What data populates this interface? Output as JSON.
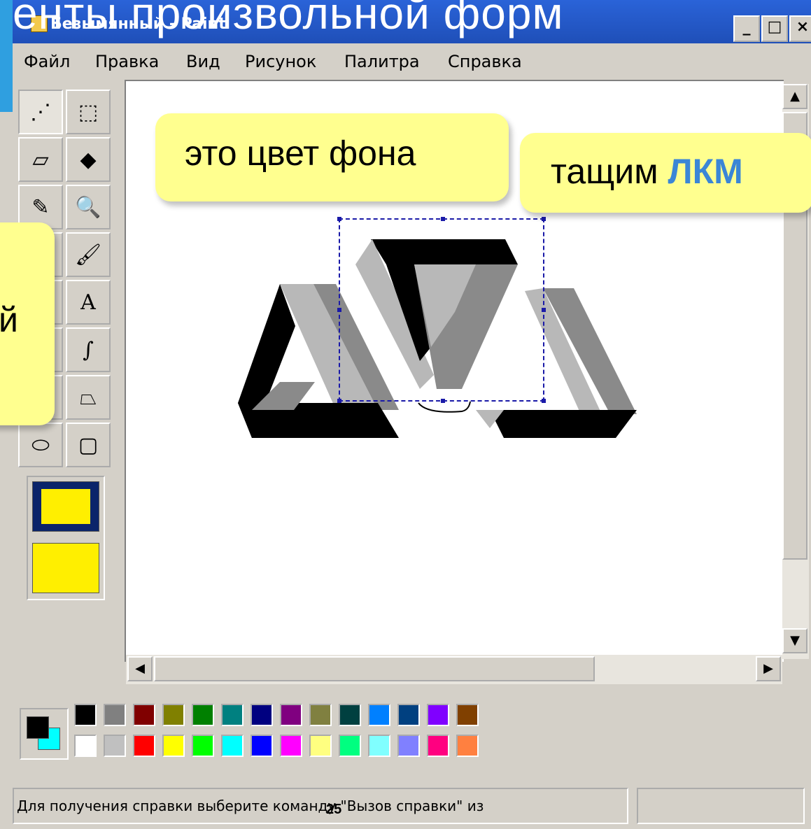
{
  "slide": {
    "title_fragment": "енты произвольной форм",
    "page_number": "25"
  },
  "window": {
    "title": "Безымянный - Paint",
    "buttons": {
      "minimize": "_",
      "maximize": "□",
      "close": "×"
    }
  },
  "menu": [
    "Файл",
    "Правка",
    "Вид",
    "Рисунок",
    "Палитра",
    "Справка"
  ],
  "toolbox": {
    "tools": [
      {
        "name": "free-select-icon",
        "glyph": "⋰"
      },
      {
        "name": "rect-select-icon",
        "glyph": "⬚"
      },
      {
        "name": "eraser-icon",
        "glyph": "▱"
      },
      {
        "name": "fill-icon",
        "glyph": "◆"
      },
      {
        "name": "eyedropper-icon",
        "glyph": "✎"
      },
      {
        "name": "magnifier-icon",
        "glyph": "🔍"
      },
      {
        "name": "pencil-icon",
        "glyph": "✏"
      },
      {
        "name": "brush-icon",
        "glyph": "🖌"
      },
      {
        "name": "airbrush-icon",
        "glyph": "◗"
      },
      {
        "name": "text-icon",
        "glyph": "A"
      },
      {
        "name": "line-icon",
        "glyph": "╲"
      },
      {
        "name": "curve-icon",
        "glyph": "∫"
      },
      {
        "name": "rectangle-icon",
        "glyph": "□"
      },
      {
        "name": "polygon-icon",
        "glyph": "⏢"
      },
      {
        "name": "ellipse-icon",
        "glyph": "⬭"
      },
      {
        "name": "rounded-rect-icon",
        "glyph": "▢"
      }
    ]
  },
  "callouts": {
    "background_color": "это цвет фона",
    "drag_prefix": "тащим ",
    "drag_key": "ЛКМ",
    "left_fragment": "й"
  },
  "palette": {
    "top_row": [
      "#000000",
      "#808080",
      "#800000",
      "#808000",
      "#008000",
      "#008080",
      "#000080",
      "#800080",
      "#808040",
      "#004040",
      "#0080ff",
      "#004080",
      "#8000ff",
      "#804000"
    ],
    "bottom_row": [
      "#ffffff",
      "#c0c0c0",
      "#ff0000",
      "#ffff00",
      "#00ff00",
      "#00ffff",
      "#0000ff",
      "#ff00ff",
      "#ffff80",
      "#00ff80",
      "#80ffff",
      "#8080ff",
      "#ff0080",
      "#ff8040"
    ],
    "foreground": "#000000",
    "background": "#00ffff"
  },
  "status": {
    "text": "Для получения справки выберите команду \"Вызов справки\" из"
  },
  "colors": {
    "callout": "#ffff8f",
    "accent": "#3b86d6",
    "selection": "#1a1aa8"
  }
}
